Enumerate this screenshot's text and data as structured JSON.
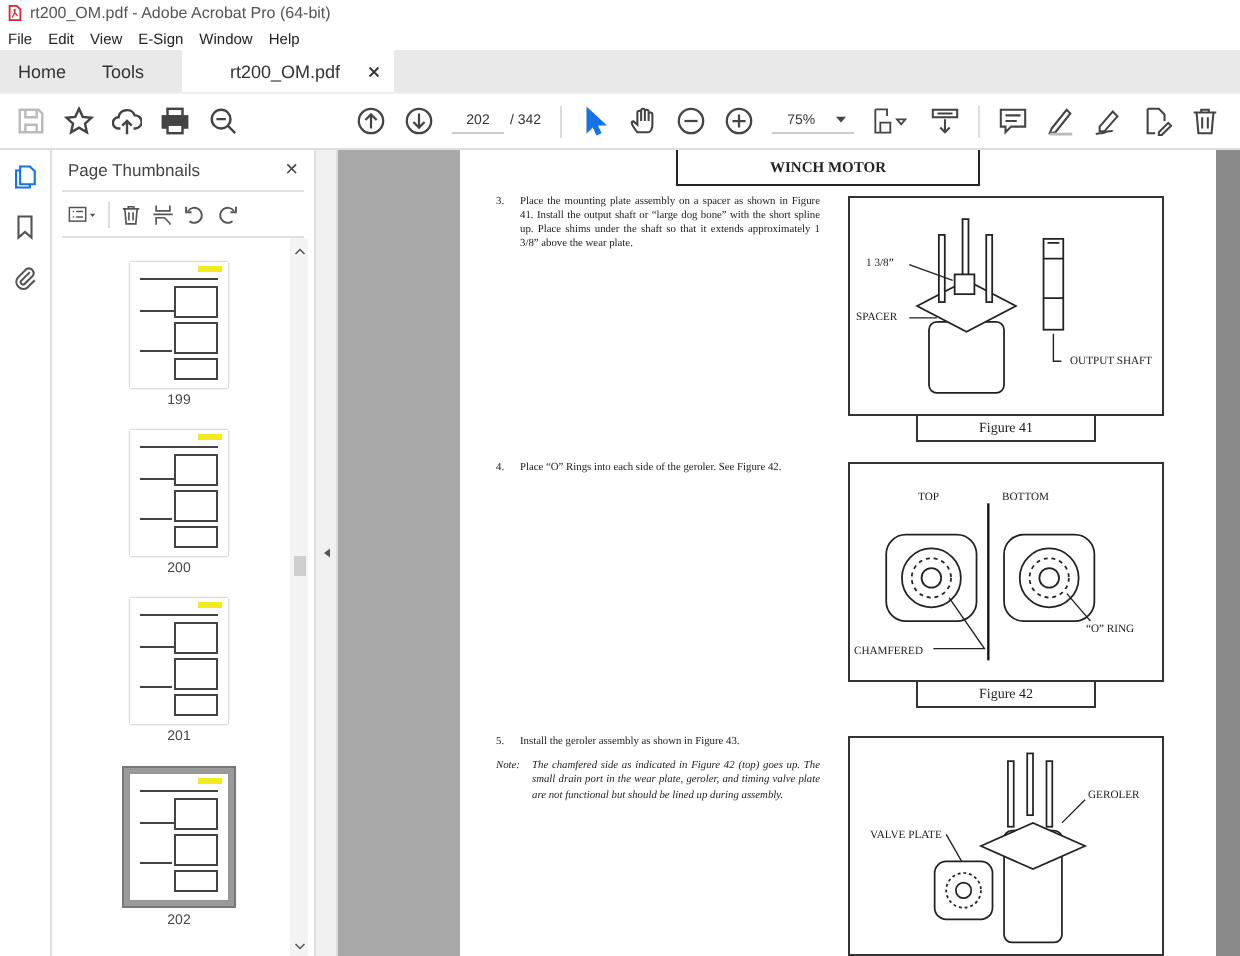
{
  "window": {
    "title": "rt200_OM.pdf - Adobe Acrobat Pro (64-bit)"
  },
  "menu": [
    "File",
    "Edit",
    "View",
    "E-Sign",
    "Window",
    "Help"
  ],
  "tabs": [
    {
      "label": "Home",
      "selected": false,
      "closable": false
    },
    {
      "label": "Tools",
      "selected": false,
      "closable": false
    },
    {
      "label": "rt200_OM.pdf",
      "selected": true,
      "closable": true
    }
  ],
  "toolbar": {
    "left_tools": [
      {
        "kind": "save",
        "disabled": true
      },
      {
        "kind": "star",
        "disabled": false
      },
      {
        "kind": "upload",
        "disabled": false
      },
      {
        "kind": "print",
        "disabled": false
      },
      {
        "kind": "zoom-search",
        "disabled": false
      }
    ],
    "page_current": "202",
    "page_total": "/ 342",
    "zoom": "75%",
    "right_tools": [
      {
        "kind": "comment",
        "selected": false
      },
      {
        "kind": "pen",
        "selected": false
      },
      {
        "kind": "sign",
        "selected": false
      },
      {
        "kind": "edit",
        "selected": false
      },
      {
        "kind": "trash",
        "selected": false
      }
    ],
    "view_tools": [
      {
        "kind": "select",
        "selected": true
      },
      {
        "kind": "hand",
        "selected": false
      }
    ]
  },
  "rail": [
    {
      "kind": "pages",
      "selected": true
    },
    {
      "kind": "bookmark",
      "selected": false
    },
    {
      "kind": "attachment",
      "selected": false
    }
  ],
  "panel": {
    "title": "Page Thumbnails",
    "close": "×",
    "thumbnails": [
      {
        "label": "199",
        "selected": false
      },
      {
        "label": "200",
        "selected": false
      },
      {
        "label": "201",
        "selected": false
      },
      {
        "label": "202",
        "selected": true
      }
    ]
  },
  "document": {
    "header": "WINCH MOTOR",
    "sections": [
      {
        "kind": "step",
        "number": "3.",
        "text": "Place the mounting plate assembly on a spacer as shown in Figure 41. Install the output shaft or “large dog bone” with the short spline up. Place shims under the shaft so that it extends approximately 1 3/8” above the wear plate.",
        "figure": {
          "kind": "shaft",
          "caption": "Figure 41",
          "labels": [
            "1 3/8”",
            "SPACER",
            "OUTPUT SHAFT"
          ]
        }
      },
      {
        "kind": "step",
        "number": "4.",
        "text": "Place “O” Rings into each side of the geroler. See Figure 42.",
        "figure": {
          "kind": "rings",
          "caption": "Figure 42",
          "labels": [
            "TOP",
            "BOTTOM",
            "CHAMFERED",
            "“O” RING"
          ]
        }
      },
      {
        "kind": "step",
        "number": "5.",
        "text": "Install the geroler assembly as shown in Figure 43.",
        "note_label": "Note:",
        "note": "The chamfered side as indicated in Figure 42 (top) goes up. The small drain port in the wear plate, geroler, and timing valve plate are not functional but should be lined up during assembly.",
        "figure": {
          "kind": "geroler",
          "labels": [
            "GEROLER",
            "VALVE PLATE"
          ]
        }
      }
    ]
  }
}
